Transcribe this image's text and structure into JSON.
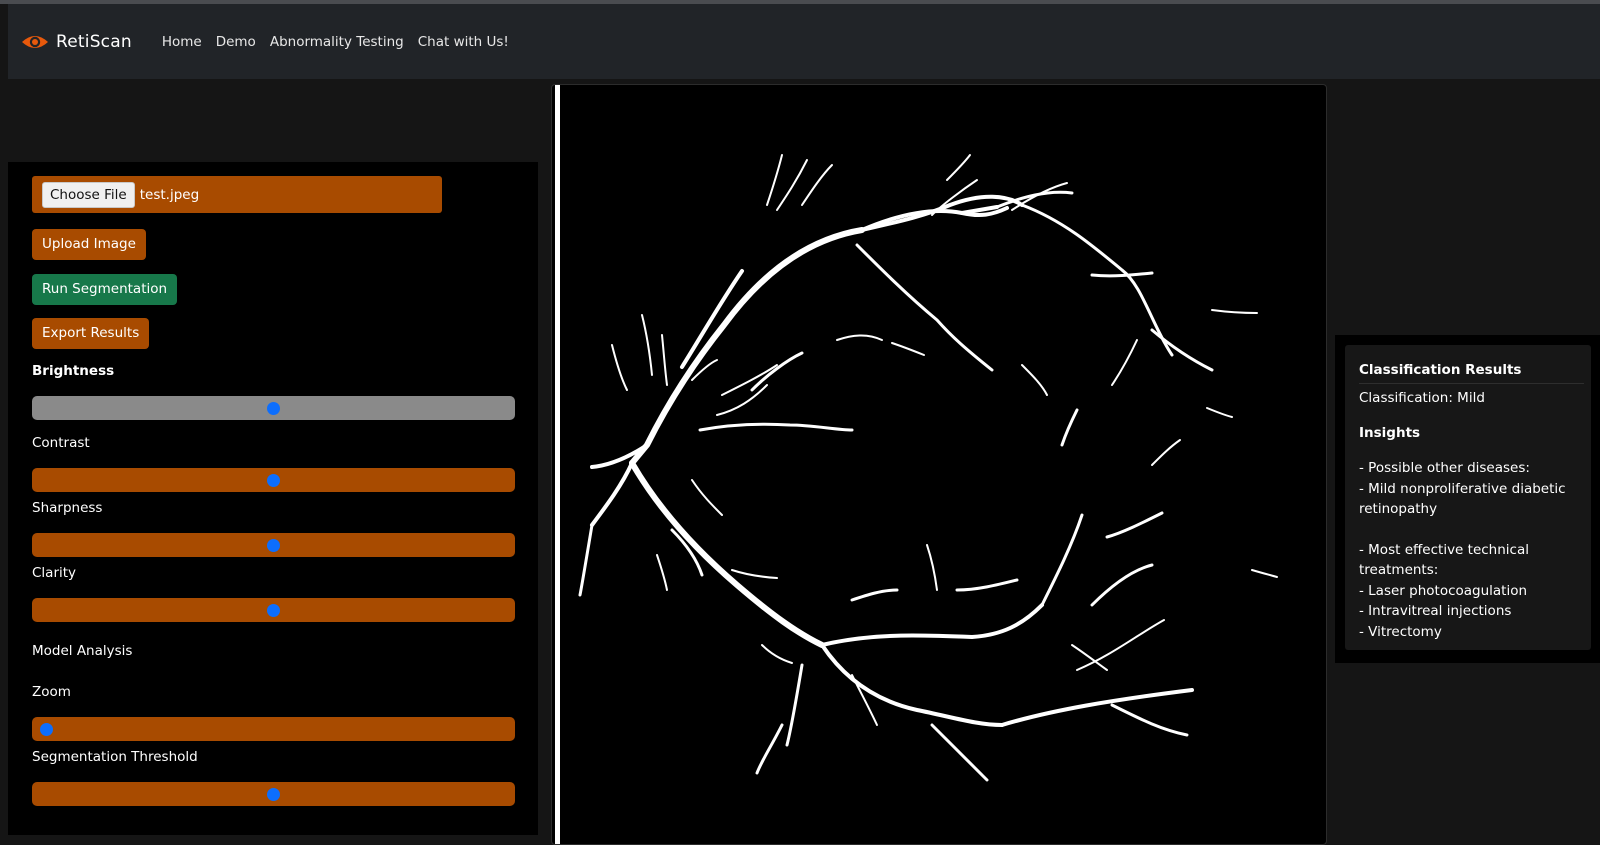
{
  "app": {
    "name": "RetiScan",
    "brand_icon": "eye-icon",
    "accent": "#a84b00",
    "icon_color": "#e8590c"
  },
  "nav": {
    "items": [
      "Home",
      "Demo",
      "Abnormality Testing",
      "Chat with Us!"
    ]
  },
  "controls": {
    "file_button": "Choose File",
    "file_name": "test.jpeg",
    "upload_button": "Upload Image",
    "run_button": "Run Segmentation",
    "export_button": "Export Results",
    "brightness_label": "Brightness",
    "contrast_label": "Contrast",
    "sharpness_label": "Sharpness",
    "clarity_label": "Clarity",
    "model_analysis_label": "Model Analysis",
    "zoom_label": "Zoom",
    "threshold_label": "Segmentation Threshold",
    "brightness_value": 0.5,
    "contrast_value": 0.5,
    "sharpness_value": 0.5,
    "clarity_value": 0.5,
    "zoom_value": 0.03,
    "threshold_value": 0.5,
    "slider_thumb_color": "#0d6efd",
    "run_button_color": "#17784a"
  },
  "results": {
    "title": "Classification Results",
    "classification": "Classification: Mild",
    "insights_title": "Insights",
    "lines": [
      "- Possible other diseases:",
      "- Mild nonproliferative diabetic",
      "retinopathy",
      "- Most effective technical",
      "treatments:",
      "- Laser photocoagulation",
      "- Intravitreal injections",
      "- Vitrectomy"
    ]
  }
}
